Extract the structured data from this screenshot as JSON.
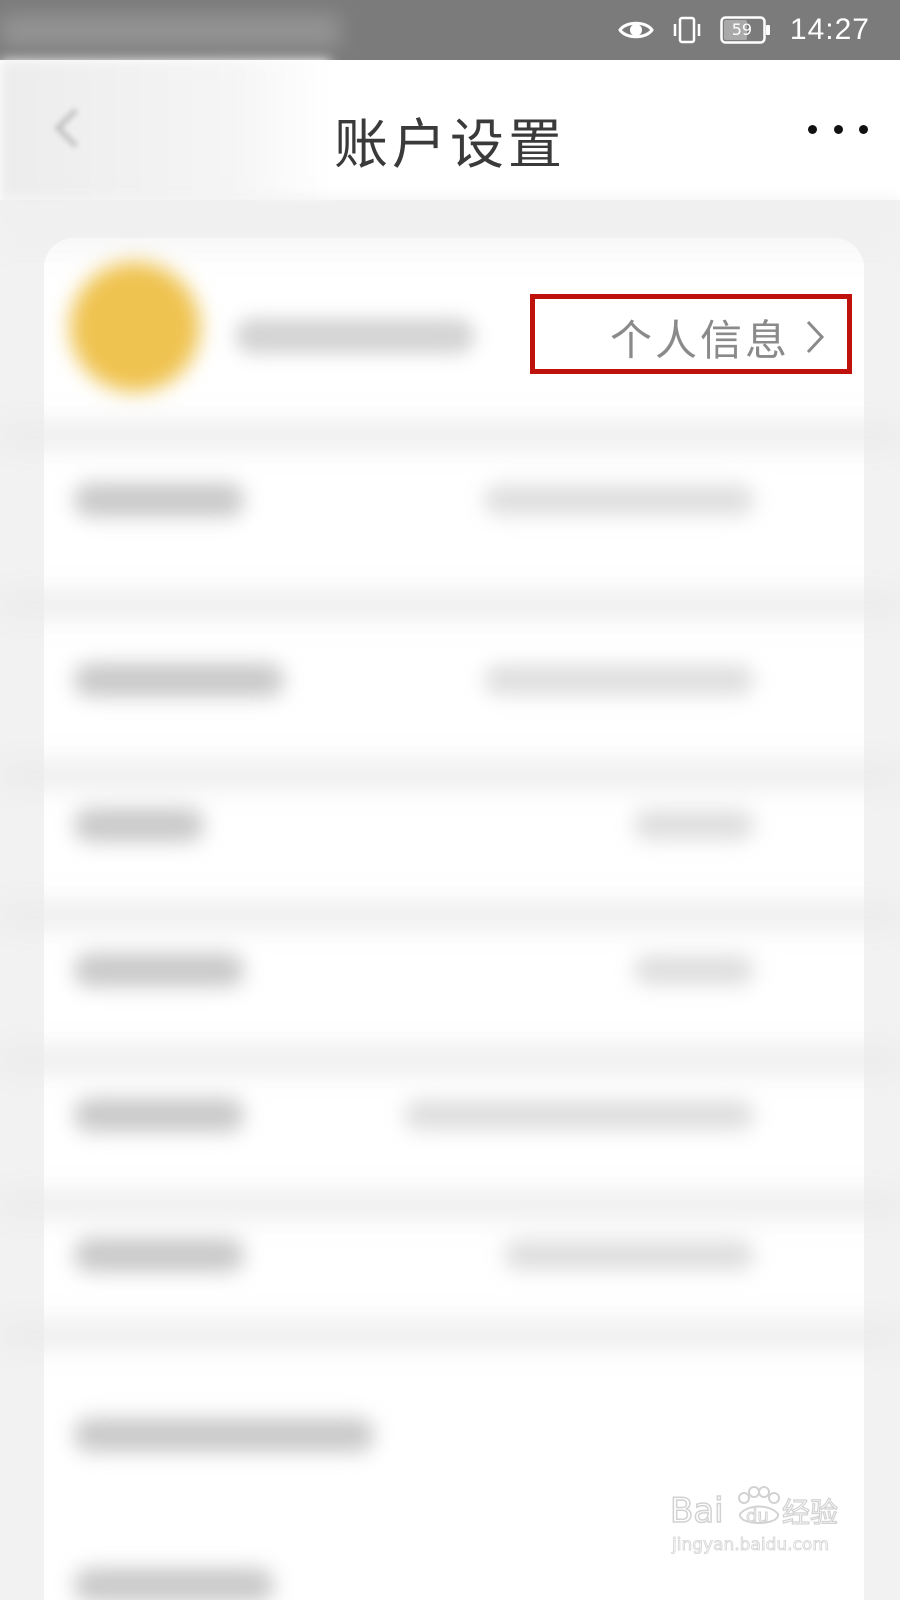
{
  "status_bar": {
    "battery_level": "59",
    "time": "14:27",
    "icons": [
      "eye-icon",
      "vibrate-icon",
      "battery-icon"
    ]
  },
  "header": {
    "title": "账户设置",
    "back_icon": "back-arrow-icon",
    "more_icon": "more-icon"
  },
  "profile": {
    "personal_info_label": "个人信息",
    "avatar_color": "#efc350",
    "highlight_color": "#c0120c"
  },
  "watermark": {
    "brand": "Baidu经验",
    "url": "jingyan.baidu.com"
  }
}
